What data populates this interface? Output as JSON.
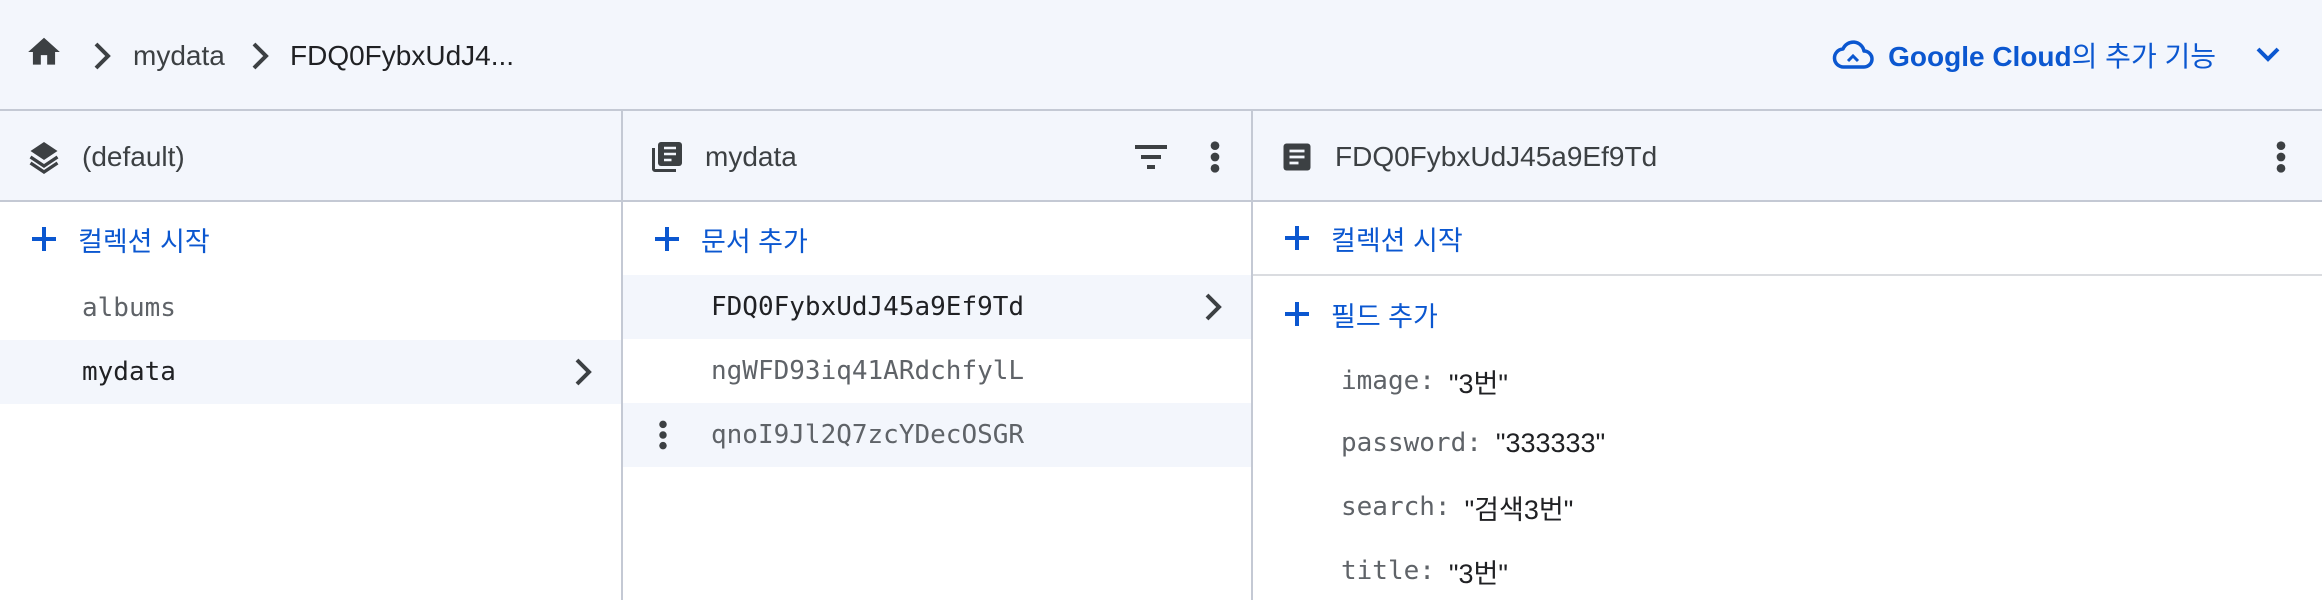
{
  "breadcrumb": {
    "items": [
      "mydata",
      "FDQ0FybxUdJ4..."
    ]
  },
  "header_action": {
    "label_brand": "Google Cloud",
    "label_suffix": "의 추가 기능"
  },
  "colors": {
    "accent": "#0b57d0",
    "panel_bg": "#f3f6fc",
    "border": "#c4c9d4"
  },
  "database_panel": {
    "title": "(default)",
    "add_label": "컬렉션 시작",
    "items": [
      {
        "label": "albums"
      },
      {
        "label": "mydata"
      }
    ]
  },
  "collection_panel": {
    "title": "mydata",
    "add_label": "문서 추가",
    "items": [
      {
        "label": "FDQ0FybxUdJ45a9Ef9Td"
      },
      {
        "label": "ngWFD93iq41ARdchfylL"
      },
      {
        "label": "qnoI9Jl2Q7zcYDecOSGR"
      }
    ]
  },
  "document_panel": {
    "title": "FDQ0FybxUdJ45a9Ef9Td",
    "add_collection_label": "컬렉션 시작",
    "add_field_label": "필드 추가",
    "fields": [
      {
        "key": "image:",
        "value": "\"3번\""
      },
      {
        "key": "password:",
        "value": "\"333333\""
      },
      {
        "key": "search:",
        "value": "\"검색3번\""
      },
      {
        "key": "title:",
        "value": "\"3번\""
      }
    ]
  }
}
